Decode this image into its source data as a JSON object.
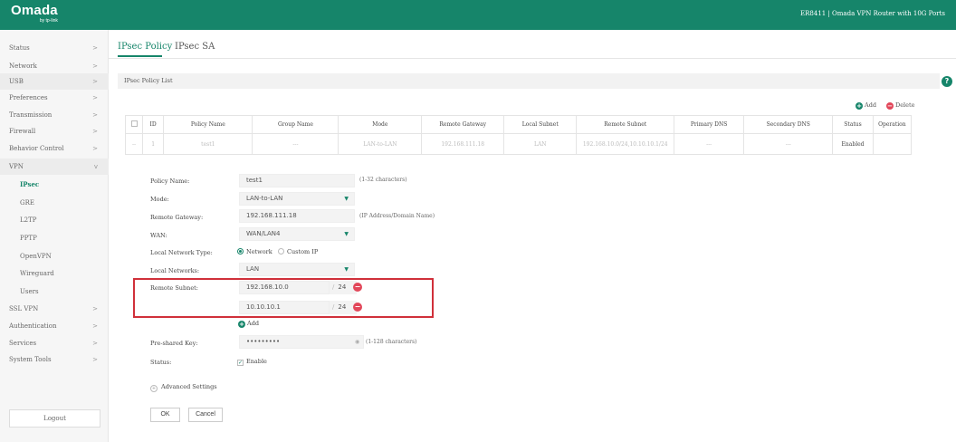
{
  "header": {
    "logo": "Omada",
    "logo_sub": "by tp-link",
    "device": "ER8411  |  Omada VPN Router with 10G Ports"
  },
  "sidebar": {
    "items": [
      {
        "label": "Status",
        "chevron": ">"
      },
      {
        "label": "Network",
        "chevron": ">"
      },
      {
        "label": "USB",
        "chevron": ">"
      },
      {
        "label": "Preferences",
        "chevron": ">"
      },
      {
        "label": "Transmission",
        "chevron": ">"
      },
      {
        "label": "Firewall",
        "chevron": ">"
      },
      {
        "label": "Behavior Control",
        "chevron": ">"
      },
      {
        "label": "VPN",
        "chevron": "v"
      },
      {
        "label": "IPsec"
      },
      {
        "label": "GRE"
      },
      {
        "label": "L2TP"
      },
      {
        "label": "PPTP"
      },
      {
        "label": "OpenVPN"
      },
      {
        "label": "Wireguard"
      },
      {
        "label": "Users"
      },
      {
        "label": "SSL VPN",
        "chevron": ">"
      },
      {
        "label": "Authentication",
        "chevron": ">"
      },
      {
        "label": "Services",
        "chevron": ">"
      },
      {
        "label": "System Tools",
        "chevron": ">"
      }
    ],
    "logout": "Logout"
  },
  "tabs": [
    {
      "label": "IPsec Policy",
      "active": true
    },
    {
      "label": "IPsec SA",
      "active": false
    }
  ],
  "section_title": "IPsec Policy List",
  "help_icon": "?",
  "toolbar": {
    "add": "Add",
    "delete": "Delete"
  },
  "table": {
    "columns": [
      "",
      "ID",
      "Policy Name",
      "Group Name",
      "Mode",
      "Remote Gateway",
      "Local Subnet",
      "Remote Subnet",
      "Primary DNS",
      "Secondary DNS",
      "Status",
      "Operation"
    ],
    "rows": [
      [
        "--",
        "1",
        "test1",
        "---",
        "LAN-to-LAN",
        "192.168.111.18",
        "LAN",
        "192.168.10.0/24,10.10.10.1/24",
        "---",
        "---",
        "Enabled",
        ""
      ]
    ]
  },
  "form": {
    "policy_name": {
      "label": "Policy Name:",
      "value": "test1",
      "hint": "(1-32 characters)"
    },
    "mode": {
      "label": "Mode:",
      "value": "LAN-to-LAN"
    },
    "remote_gateway": {
      "label": "Remote Gateway:",
      "value": "192.168.111.18",
      "hint": "(IP Address/Domain Name)"
    },
    "wan": {
      "label": "WAN:",
      "value": "WAN/LAN4"
    },
    "local_network_type": {
      "label": "Local Network Type:",
      "option1": "Network",
      "option2": "Custom IP",
      "selected": "Network"
    },
    "local_networks": {
      "label": "Local Networks:",
      "value": "LAN"
    },
    "remote_subnet": {
      "label": "Remote Subnet:",
      "entries": [
        {
          "ip": "192.168.10.0",
          "mask": "24"
        },
        {
          "ip": "10.10.10.1",
          "mask": "24"
        }
      ],
      "add": "Add"
    },
    "pre_shared_key": {
      "label": "Pre-shared Key:",
      "value": "•••••••••",
      "hint": "(1-128 characters)"
    },
    "status": {
      "label": "Status:",
      "checkbox": "Enable",
      "checked": true
    },
    "advanced": "Advanced Settings",
    "ok": "OK",
    "cancel": "Cancel"
  },
  "colors": {
    "brand": "#16856a",
    "danger": "#e2475a",
    "highlight_box": "#d0303a"
  }
}
